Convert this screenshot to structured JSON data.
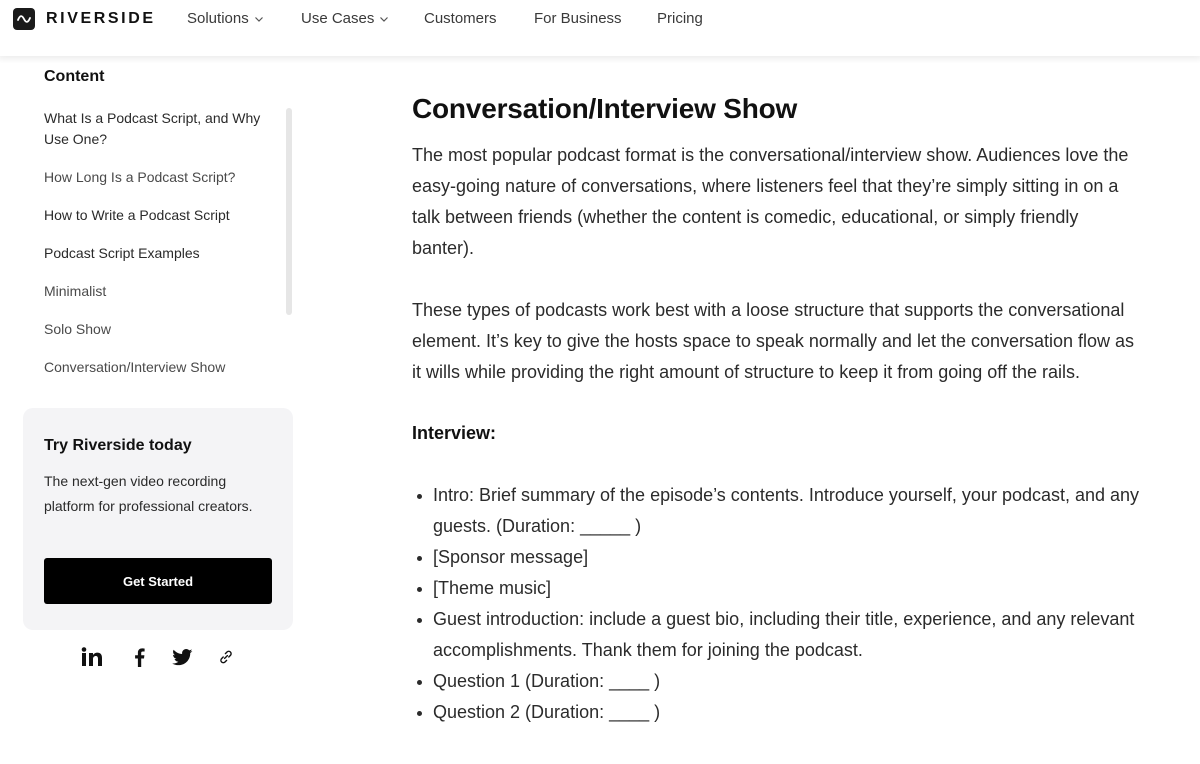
{
  "nav": {
    "brand": "RIVERSIDE",
    "brand_icon": "waveform-icon",
    "items": [
      {
        "label": "Solutions",
        "has_dropdown": true
      },
      {
        "label": "Use Cases",
        "has_dropdown": true
      },
      {
        "label": "Customers",
        "has_dropdown": false
      },
      {
        "label": "For Business",
        "has_dropdown": false
      },
      {
        "label": "Pricing",
        "has_dropdown": false
      }
    ]
  },
  "sidebar": {
    "toc_title": "Content",
    "toc_items": [
      {
        "label": "What Is a Podcast Script, and Why Use One?"
      },
      {
        "label": "How Long Is a Podcast Script?"
      },
      {
        "label": "How to Write a Podcast Script"
      },
      {
        "label": "Podcast Script Examples"
      },
      {
        "label": "Minimalist"
      },
      {
        "label": "Solo Show"
      },
      {
        "label": "Conversation/Interview Show"
      }
    ],
    "cta": {
      "title": "Try Riverside today",
      "description": "The next-gen video recording platform for professional creators.",
      "button_label": "Get Started"
    },
    "share_icons": [
      "linkedin-icon",
      "facebook-icon",
      "twitter-icon",
      "link-icon"
    ]
  },
  "article": {
    "heading": "Conversation/Interview Show",
    "paragraph_1": "The most popular podcast format is the conversational/interview show. Audiences love the easy-going nature of conversations, where listeners feel that they’re simply sitting in on a talk between friends (whether the content is comedic, educational, or simply friendly banter).",
    "paragraph_2": "These types of podcasts work best with a loose structure that supports the conversational element. It’s key to give the hosts space to speak normally and let the conversation flow as it wills while providing the right amount of structure to keep it from going off the rails.",
    "subheading": "Interview:",
    "list": [
      "Intro: Brief summary of the episode’s contents. Introduce yourself, your podcast, and any guests. (Duration: _____ )",
      "[Sponsor message]",
      "[Theme music]",
      "Guest introduction: include a guest bio, including their title, experience, and any relevant accomplishments. Thank them for joining the podcast.",
      "Question 1 (Duration: ____ )",
      "Question 2 (Duration: ____ )"
    ]
  }
}
